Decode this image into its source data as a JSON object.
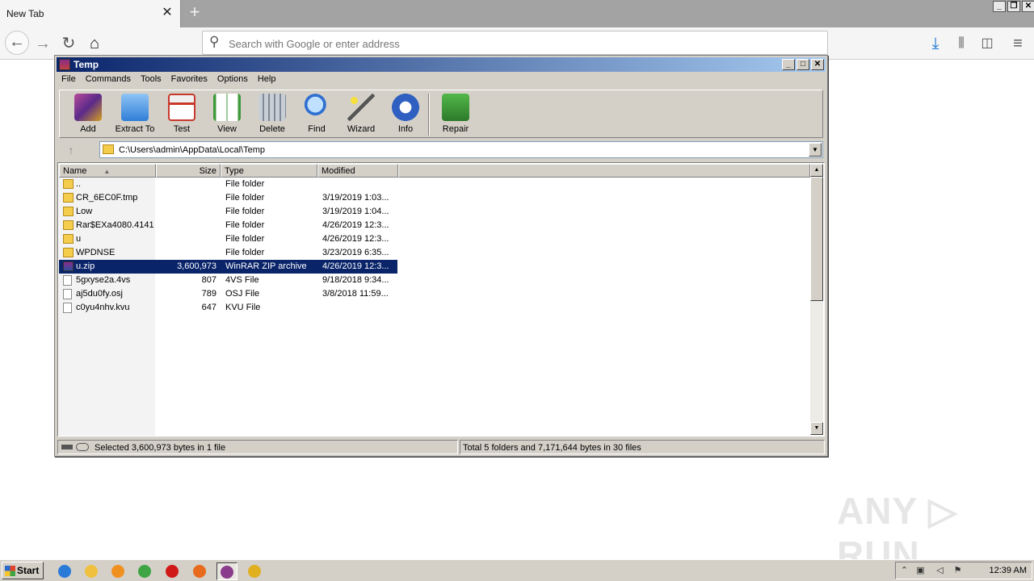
{
  "browser": {
    "tab_title": "New Tab",
    "tab_close": "✕",
    "new_tab": "+",
    "url_placeholder": "Search with Google or enter address",
    "window_buttons": [
      "_",
      "❐",
      "✕"
    ]
  },
  "winrar": {
    "title": "Temp",
    "window_buttons": [
      "_",
      "□",
      "✕"
    ],
    "menu": [
      "File",
      "Commands",
      "Tools",
      "Favorites",
      "Options",
      "Help"
    ],
    "toolbar": [
      {
        "label": "Add",
        "icon": "add-archive-icon",
        "color": "#8b3b8b"
      },
      {
        "label": "Extract To",
        "icon": "extract-folder-icon",
        "color": "#3d8ee0"
      },
      {
        "label": "Test",
        "icon": "test-clipboard-icon",
        "color": "#c8382a"
      },
      {
        "label": "View",
        "icon": "view-book-icon",
        "color": "#3f9a3a"
      },
      {
        "label": "Delete",
        "icon": "trash-icon",
        "color": "#8f9aa6"
      },
      {
        "label": "Find",
        "icon": "magnifier-icon",
        "color": "#2f6fd0"
      },
      {
        "label": "Wizard",
        "icon": "wand-icon",
        "color": "#b0b0b0"
      },
      {
        "label": "Info",
        "icon": "info-icon",
        "color": "#2f5fc0"
      },
      {
        "label": "Repair",
        "icon": "repair-kit-icon",
        "color": "#3a9a3a"
      }
    ],
    "path": "C:\\Users\\admin\\AppData\\Local\\Temp",
    "columns": {
      "name": "Name",
      "size": "Size",
      "type": "Type",
      "modified": "Modified"
    },
    "files": [
      {
        "name": "..",
        "size": "",
        "type": "File folder",
        "modified": "",
        "kind": "folder"
      },
      {
        "name": "CR_6EC0F.tmp",
        "size": "",
        "type": "File folder",
        "modified": "3/19/2019 1:03...",
        "kind": "folder"
      },
      {
        "name": "Low",
        "size": "",
        "type": "File folder",
        "modified": "3/19/2019 1:04...",
        "kind": "folder"
      },
      {
        "name": "Rar$EXa4080.4141",
        "size": "",
        "type": "File folder",
        "modified": "4/26/2019 12:3...",
        "kind": "folder"
      },
      {
        "name": "u",
        "size": "",
        "type": "File folder",
        "modified": "4/26/2019 12:3...",
        "kind": "folder"
      },
      {
        "name": "WPDNSE",
        "size": "",
        "type": "File folder",
        "modified": "3/23/2019 6:35...",
        "kind": "folder"
      },
      {
        "name": "u.zip",
        "size": "3,600,973",
        "type": "WinRAR ZIP archive",
        "modified": "4/26/2019 12:3...",
        "kind": "zip",
        "selected": true
      },
      {
        "name": "5gxyse2a.4vs",
        "size": "807",
        "type": "4VS File",
        "modified": "9/18/2018 9:34...",
        "kind": "file"
      },
      {
        "name": "aj5du0fy.osj",
        "size": "789",
        "type": "OSJ File",
        "modified": "3/8/2018 11:59...",
        "kind": "file"
      },
      {
        "name": "c0yu4nhv.kvu",
        "size": "647",
        "type": "KVU File",
        "modified": "",
        "kind": "file"
      }
    ],
    "status_left": "Selected 3,600,973 bytes in 1 file",
    "status_right": "Total 5 folders and 7,171,644 bytes in 30 files"
  },
  "taskbar": {
    "start": "Start",
    "clock": "12:39 AM",
    "apps": [
      {
        "icon": "internet-explorer-icon",
        "color": "#2a7ad8"
      },
      {
        "icon": "explorer-folder-icon",
        "color": "#f0c040"
      },
      {
        "icon": "media-player-icon",
        "color": "#f09020"
      },
      {
        "icon": "chrome-icon",
        "color": "#3fa444"
      },
      {
        "icon": "opera-icon",
        "color": "#d01818"
      },
      {
        "icon": "firefox-icon",
        "color": "#e86a1c"
      },
      {
        "icon": "winrar-icon",
        "color": "#8b3b8b",
        "active": true
      },
      {
        "icon": "chrome-canary-icon",
        "color": "#e0b020"
      }
    ]
  },
  "watermark": "ANY ▷ RUN"
}
